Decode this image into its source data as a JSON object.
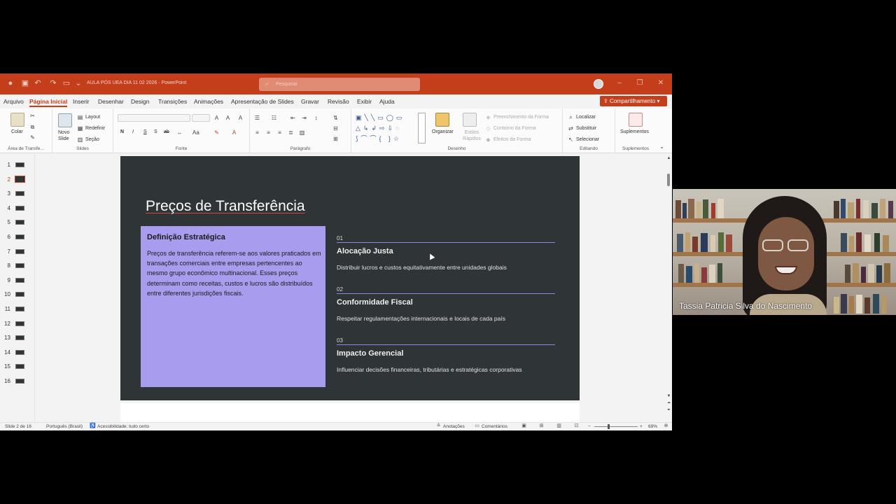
{
  "titlebar": {
    "doc_title": "AULA PÓS UEA DIA 11 02 2026  ·  PowerPoint",
    "search_placeholder": "Pesquisar"
  },
  "menu": {
    "tabs": [
      "Arquivo",
      "Página Inicial",
      "Inserir",
      "Desenhar",
      "Design",
      "Transições",
      "Animações",
      "Apresentação de Slides",
      "Gravar",
      "Revisão",
      "Exibir",
      "Ajuda"
    ],
    "active_tab": "Página Inicial",
    "share_label": "Compartilhamento"
  },
  "ribbon": {
    "clipboard": {
      "paste": "Colar",
      "group": "Área de Transfe..."
    },
    "slides": {
      "new_slide": "Novo Slide",
      "layout": "Layout",
      "reset": "Redefinir",
      "section": "Seção",
      "group": "Slides"
    },
    "font": {
      "group": "Fonte",
      "bold": "N",
      "italic": "I",
      "underline": "S",
      "shadow": "S",
      "strike": "ab"
    },
    "paragraph": {
      "group": "Parágrafo"
    },
    "drawing": {
      "arrange": "Organizar",
      "quick_styles": "Estilos Rápidos",
      "fill": "Preenchimento da Forma",
      "outline": "Contorno da Forma",
      "effects": "Efeitos da Forma",
      "group": "Desenho"
    },
    "editing": {
      "find": "Localizar",
      "replace": "Substituir",
      "select": "Selecionar",
      "group": "Editando"
    },
    "addins": {
      "label": "Suplementos",
      "group": "Suplementos"
    }
  },
  "thumbnails": {
    "count": 16,
    "active": 2,
    "numbers": [
      "1",
      "2",
      "3",
      "4",
      "5",
      "6",
      "7",
      "8",
      "9",
      "10",
      "11",
      "12",
      "13",
      "14",
      "15",
      "16"
    ]
  },
  "slide": {
    "title": "Preços de Transferência",
    "card": {
      "title": "Definição Estratégica",
      "body": "Preços de transferência referem-se aos valores praticados em transações comerciais entre empresas pertencentes ao mesmo grupo econômico multinacional. Esses preços determinam como receitas, custos e lucros são distribuídos entre diferentes jurisdições fiscais."
    },
    "items": [
      {
        "num": "01",
        "title": "Alocação Justa",
        "desc": "Distribuir lucros e custos equitativamente entre unidades globais"
      },
      {
        "num": "02",
        "title": "Conformidade Fiscal",
        "desc": "Respeitar regulamentações internacionais e locais de cada país"
      },
      {
        "num": "03",
        "title": "Impacto Gerencial",
        "desc": "Influenciar decisões financeiras, tributárias e estratégicas corporativas"
      }
    ],
    "colors": {
      "background": "#2f3436",
      "card": "#a89cee",
      "line": "#8c86e8",
      "accent": "#c43e1c"
    }
  },
  "statusbar": {
    "slide_info": "Slide 2 de 16",
    "language": "Português (Brasil)",
    "accessibility": "Acessibilidade: tudo certo",
    "notes": "Anotações",
    "comments": "Comentários",
    "zoom": "69%"
  },
  "webcam": {
    "participant_name": "Tassia Patricia Silva do Nascimento"
  }
}
